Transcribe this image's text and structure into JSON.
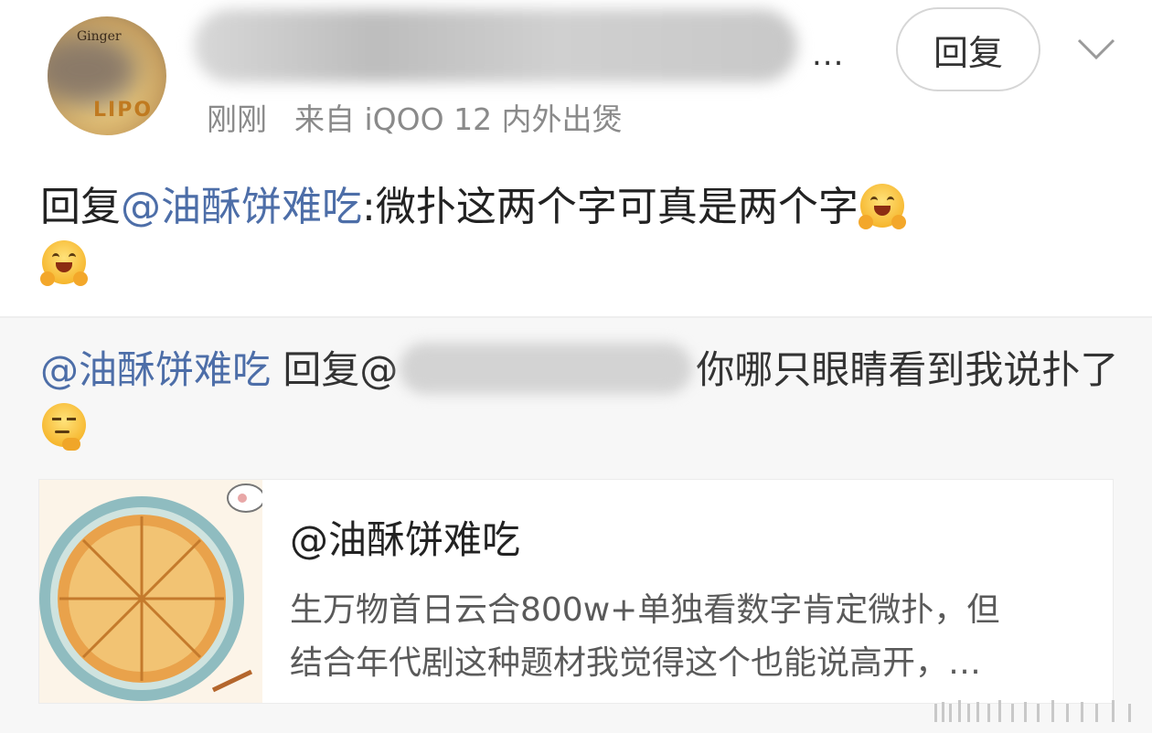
{
  "comment": {
    "time": "刚刚",
    "source": "来自 iQOO 12 内外出煲",
    "reply_button": "回复",
    "username_suffix": "...",
    "avatar_text_top": "Ginger",
    "avatar_text_bottom": "LIPO",
    "text_prefix": "回复",
    "text_mention": "@油酥饼难吃",
    "text_body": ":微扑这两个字可真是两个字",
    "emoji": "hugging-face"
  },
  "quote": {
    "mention": "@油酥饼难吃",
    "reply_label": " 回复@",
    "text_body": "你哪只眼睛看到我说扑了",
    "emoji": "thinking-face"
  },
  "card": {
    "title": "@油酥饼难吃",
    "desc_line1": "生万物首日云合800w+单独看数字肯定微扑，但",
    "desc_line2": "结合年代剧这种题材我觉得这个也能说高开，…",
    "thumbnail": "pie-illustration"
  },
  "colors": {
    "mention": "#4d6ea8",
    "text": "#222222",
    "meta": "#8a8a8a",
    "quote_bg": "#f7f7f7"
  }
}
